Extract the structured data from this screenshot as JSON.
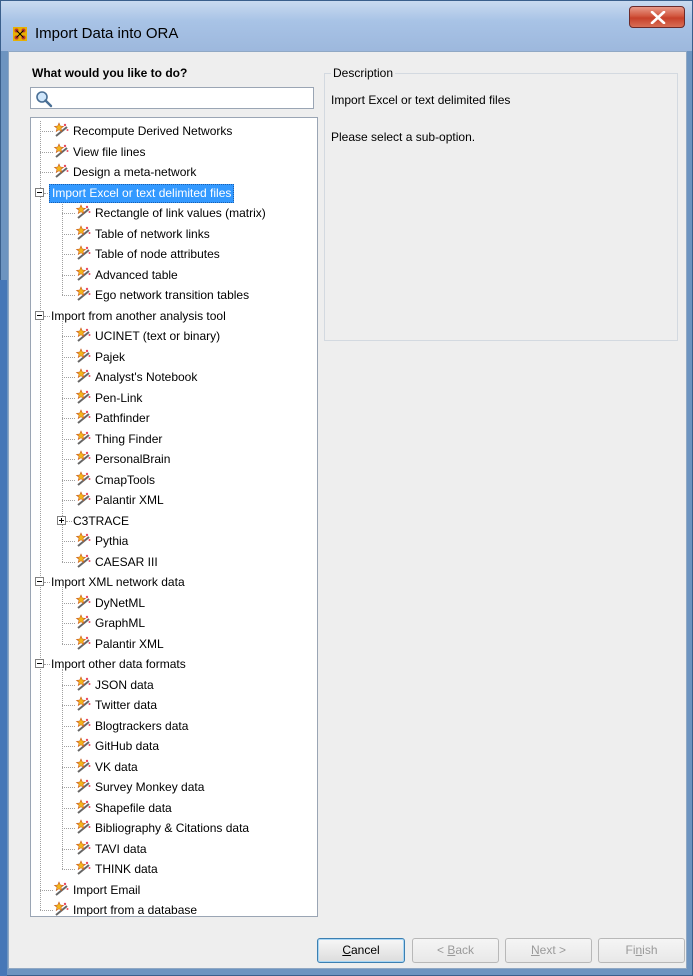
{
  "window": {
    "title": "Import Data into ORA",
    "close_label": "X"
  },
  "left": {
    "heading": "What would you like to do?",
    "search_value": ""
  },
  "tree": [
    {
      "label": "Recompute Derived Networks",
      "level": 1,
      "type": "leaf"
    },
    {
      "label": "View file lines",
      "level": 1,
      "type": "leaf"
    },
    {
      "label": "Design a meta-network",
      "level": 1,
      "type": "leaf"
    },
    {
      "label": "Import Excel or text delimited files",
      "level": 1,
      "type": "expanded",
      "selected": true
    },
    {
      "label": "Rectangle of link values (matrix)",
      "level": 2,
      "type": "leaf"
    },
    {
      "label": "Table of network links",
      "level": 2,
      "type": "leaf"
    },
    {
      "label": "Table of node attributes",
      "level": 2,
      "type": "leaf"
    },
    {
      "label": "Advanced table",
      "level": 2,
      "type": "leaf"
    },
    {
      "label": "Ego network transition tables",
      "level": 2,
      "type": "leaf"
    },
    {
      "label": "Import from another analysis tool",
      "level": 1,
      "type": "expanded"
    },
    {
      "label": "UCINET (text or binary)",
      "level": 2,
      "type": "leaf"
    },
    {
      "label": "Pajek",
      "level": 2,
      "type": "leaf"
    },
    {
      "label": "Analyst's Notebook",
      "level": 2,
      "type": "leaf"
    },
    {
      "label": "Pen-Link",
      "level": 2,
      "type": "leaf"
    },
    {
      "label": "Pathfinder",
      "level": 2,
      "type": "leaf"
    },
    {
      "label": "Thing Finder",
      "level": 2,
      "type": "leaf"
    },
    {
      "label": "PersonalBrain",
      "level": 2,
      "type": "leaf"
    },
    {
      "label": "CmapTools",
      "level": 2,
      "type": "leaf"
    },
    {
      "label": "Palantir XML",
      "level": 2,
      "type": "leaf"
    },
    {
      "label": "C3TRACE",
      "level": 2,
      "type": "collapsed"
    },
    {
      "label": "Pythia",
      "level": 2,
      "type": "leaf"
    },
    {
      "label": "CAESAR III",
      "level": 2,
      "type": "leaf"
    },
    {
      "label": "Import XML network data",
      "level": 1,
      "type": "expanded"
    },
    {
      "label": "DyNetML",
      "level": 2,
      "type": "leaf"
    },
    {
      "label": "GraphML",
      "level": 2,
      "type": "leaf"
    },
    {
      "label": "Palantir XML",
      "level": 2,
      "type": "leaf"
    },
    {
      "label": "Import other data formats",
      "level": 1,
      "type": "expanded"
    },
    {
      "label": "JSON data",
      "level": 2,
      "type": "leaf"
    },
    {
      "label": "Twitter data",
      "level": 2,
      "type": "leaf"
    },
    {
      "label": "Blogtrackers data",
      "level": 2,
      "type": "leaf"
    },
    {
      "label": "GitHub data",
      "level": 2,
      "type": "leaf"
    },
    {
      "label": "VK data",
      "level": 2,
      "type": "leaf"
    },
    {
      "label": "Survey Monkey data",
      "level": 2,
      "type": "leaf"
    },
    {
      "label": "Shapefile data",
      "level": 2,
      "type": "leaf"
    },
    {
      "label": "Bibliography & Citations data",
      "level": 2,
      "type": "leaf"
    },
    {
      "label": "TAVI data",
      "level": 2,
      "type": "leaf"
    },
    {
      "label": "THINK data",
      "level": 2,
      "type": "leaf"
    },
    {
      "label": "Import Email",
      "level": 1,
      "type": "leaf"
    },
    {
      "label": "Import from a database",
      "level": 1,
      "type": "leaf"
    }
  ],
  "description": {
    "legend": "Description",
    "line1": "Import Excel or text delimited files",
    "line2": "Please select a sub-option."
  },
  "buttons": {
    "cancel": {
      "pre": "",
      "mnemonic": "C",
      "post": "ancel"
    },
    "back": {
      "pre": "< ",
      "mnemonic": "B",
      "post": "ack"
    },
    "next": {
      "pre": "",
      "mnemonic": "N",
      "post": "ext >"
    },
    "finish": {
      "pre": "Fi",
      "mnemonic": "n",
      "post": "ish"
    }
  },
  "colors": {
    "selection": "#3399ff",
    "titlebar": "#a8c3e6",
    "close": "#c7402a"
  }
}
